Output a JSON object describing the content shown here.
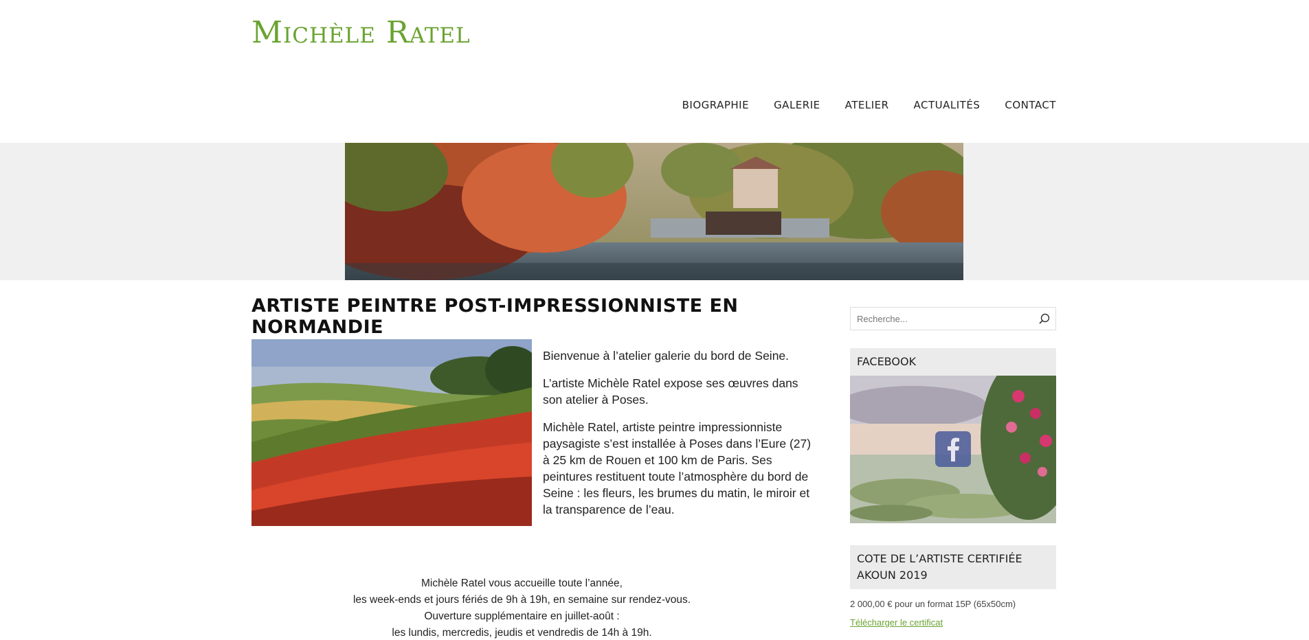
{
  "site": {
    "title": "Michèle Ratel"
  },
  "nav": {
    "items": [
      {
        "label": "Biographie"
      },
      {
        "label": "Galerie"
      },
      {
        "label": "Atelier"
      },
      {
        "label": "Actualités"
      },
      {
        "label": "Contact"
      }
    ]
  },
  "main": {
    "heading": "Artiste peintre post-impressionniste en Normandie",
    "paragraphs": [
      "Bienvenue à l’atelier galerie du bord de Seine.",
      "L’artiste Michèle Ratel expose ses œuvres dans son atelier à Poses.",
      "Michèle Ratel, artiste peintre impressionniste paysagiste s’est installée à Poses dans l’Eure (27) à 25 km de Rouen et 100 km de Paris. Ses peintures restituent toute l’atmosphère du bord de Seine : les fleurs, les brumes du matin, le miroir et la transparence de l’eau."
    ],
    "hours": [
      "Michèle Ratel vous accueille toute l’année,",
      "les week-ends et jours fériés de 9h à 19h, en semaine sur rendez-vous.",
      "Ouverture supplémentaire en juillet-août :",
      "les lundis, mercredis, jeudis et vendredis de 14h à 19h."
    ]
  },
  "sidebar": {
    "search": {
      "placeholder": "Recherche..."
    },
    "facebook": {
      "title": "Facebook"
    },
    "cote": {
      "title": "Cote de l’artiste certifiée Akoun 2019",
      "price": "2 000,00 € pour un format 15P (65x50cm)",
      "link": "Télécharger le certificat"
    }
  },
  "colors": {
    "accent": "#6aa331",
    "band": "#f0f0f0",
    "widget": "#ebebeb"
  }
}
